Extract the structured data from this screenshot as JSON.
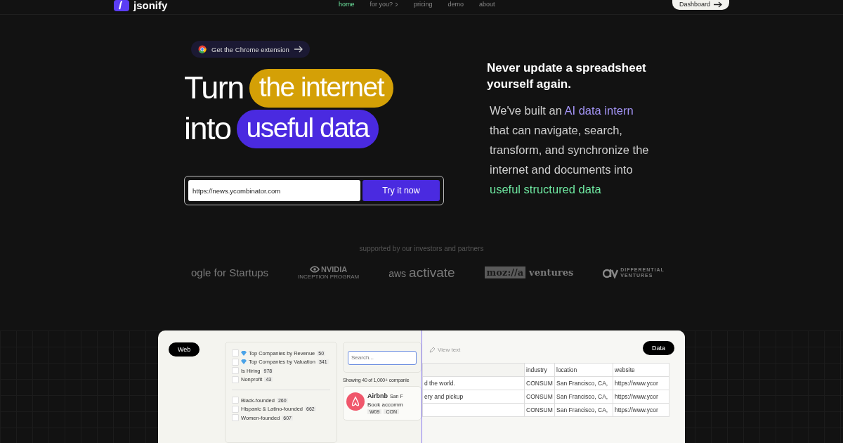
{
  "nav": {
    "logo": "jsonify",
    "links": [
      {
        "label": "home",
        "selected": true
      },
      {
        "label": "for you?",
        "selected": false,
        "menu": true
      },
      {
        "label": "pricing",
        "selected": false
      },
      {
        "label": "demo",
        "selected": false
      },
      {
        "label": "about",
        "selected": false
      }
    ],
    "dashboard": "Dashboard"
  },
  "hero": {
    "chip": "Get the Chrome extension",
    "line1": {
      "plain": "Turn",
      "pill": "the internet"
    },
    "line2": {
      "plain": "into",
      "pill": "useful data"
    },
    "url_value": "https://news.ycombinator.com",
    "button": "Try it now"
  },
  "pitch": {
    "heading": "Never update a spreadsheet yourself again.",
    "paragraph": [
      {
        "kind": "plain",
        "text": "We've built an "
      },
      {
        "kind": "accent",
        "text": "AI data intern"
      },
      {
        "kind": "plain",
        "text": " that can navigate, search, transform, and synchronize the internet and documents into "
      },
      {
        "kind": "success",
        "text": "useful structured data"
      }
    ]
  },
  "partners": {
    "caption": "supported by our investors and partners",
    "logos": [
      {
        "kind": "google",
        "text": "ogle for Startups"
      },
      {
        "kind": "nvidia",
        "text": "NVIDIA",
        "sub": "INCEPTION PROGRAM"
      },
      {
        "kind": "aws",
        "text": "aws",
        "sub": "activate"
      },
      {
        "kind": "mozilla",
        "text": "moz://a",
        "sub": "ventures"
      },
      {
        "kind": "differential",
        "text": "DIFFERENTIAL",
        "sub": "VENTURES"
      }
    ]
  },
  "demo": {
    "web_badge": "Web",
    "data_badge": "Data",
    "filters": [
      {
        "label": "Top Companies by Revenue",
        "count": "50",
        "gem": true,
        "checked": false
      },
      {
        "label": "Top Companies by Valuation",
        "count": "341",
        "gem": true,
        "checked": false
      },
      {
        "label": "Is Hiring",
        "count": "978",
        "gem": false,
        "checked": false
      },
      {
        "label": "Nonprofit",
        "count": "43",
        "gem": false,
        "checked": false
      }
    ],
    "filters2": [
      {
        "label": "Black-founded",
        "count": "260",
        "checked": false
      },
      {
        "label": "Hispanic & Latino-founded",
        "count": "662",
        "checked": false
      },
      {
        "label": "Women-founded",
        "count": "607",
        "checked": false
      }
    ],
    "search": {
      "placeholder": "Search..."
    },
    "showing": "Showing 40 of 1,000+ companie",
    "company": {
      "name": "Airbnb",
      "location": "San F",
      "desc": "Book accomm",
      "tags": [
        "W09",
        "CON"
      ]
    },
    "view_text": "View text",
    "table": {
      "columns": [
        "",
        "industry",
        "location",
        "website"
      ],
      "rows": [
        [
          "d the world.",
          "CONSUM",
          "San Francisco, CA,",
          "https://www.ycor"
        ],
        [
          "ery and pickup",
          "CONSUM",
          "San Francisco, CA,",
          "https://www.ycor"
        ],
        [
          "",
          "CONSUM",
          "San Francisco, CA,",
          "https://www.ycor"
        ]
      ]
    }
  }
}
